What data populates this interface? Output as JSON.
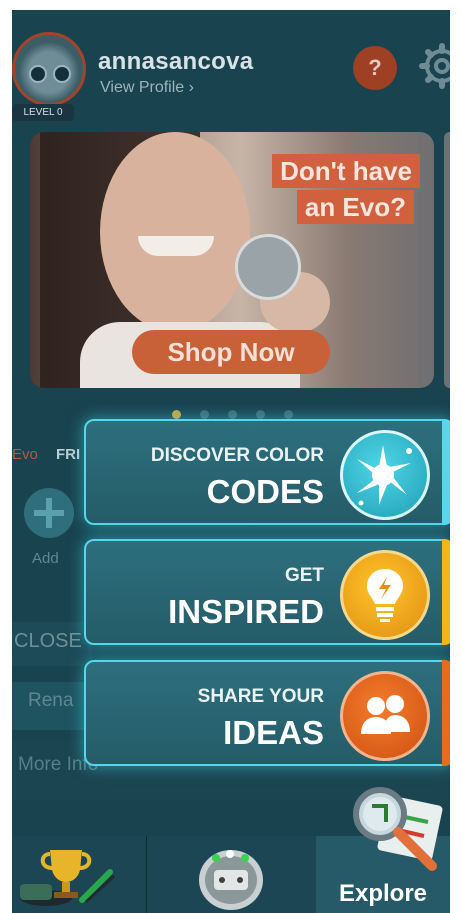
{
  "header": {
    "username": "annasancova",
    "view_profile": "View Profile ›",
    "level": "LEVEL 0",
    "help_label": "?"
  },
  "banner": {
    "headline_line1": "Don't have",
    "headline_line2": "an Evo?",
    "cta": "Shop Now",
    "page_count": 5,
    "active_page": 1
  },
  "background": {
    "tab_evo": "Evo",
    "tab_friends": "FRI",
    "add_label": "Add",
    "close_label": "CLOSE",
    "rename_label": "Rena",
    "more_info_label": "More Info"
  },
  "explore_menu": {
    "items": [
      {
        "small": "DISCOVER COLOR",
        "big": "CODES",
        "icon": "splash-icon",
        "accent": "#58d7ea"
      },
      {
        "small": "GET",
        "big": "INSPIRED",
        "icon": "lightbulb-icon",
        "accent": "#f1b716"
      },
      {
        "small": "SHARE YOUR",
        "big": "IDEAS",
        "icon": "people-icon",
        "accent": "#ea6a22"
      }
    ]
  },
  "bottom_nav": {
    "explore_label": "Explore"
  },
  "colors": {
    "background": "#19434f",
    "card_glow": "#53d7eb",
    "promo_orange": "#d1613e"
  }
}
